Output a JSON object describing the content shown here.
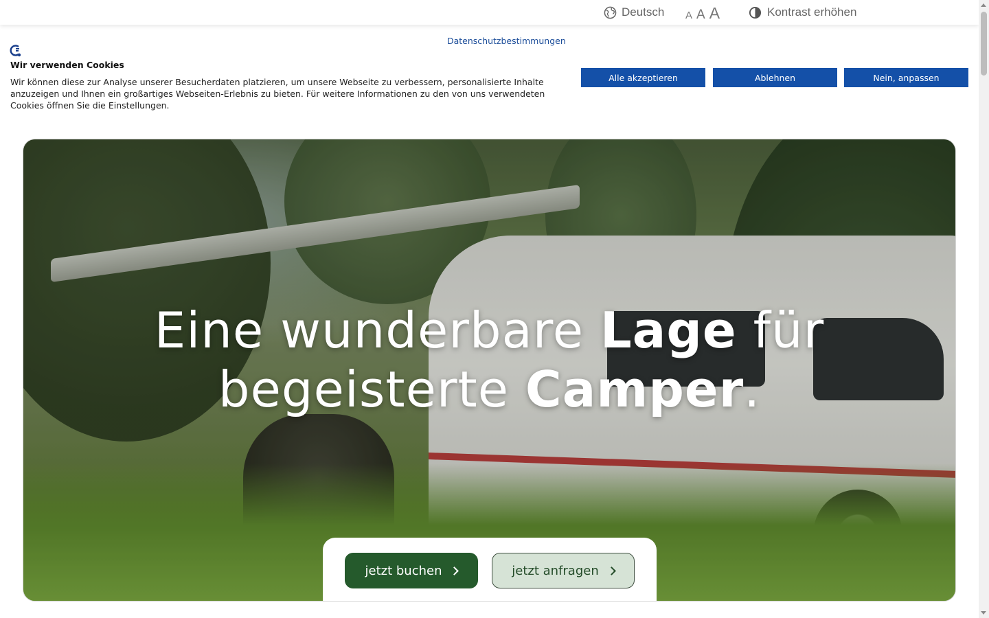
{
  "topbar": {
    "language_label": "Deutsch",
    "font_size_small": "A",
    "font_size_medium": "A",
    "font_size_large": "A",
    "contrast_label": "Kontrast erhöhen"
  },
  "cookie_banner": {
    "policy_link": "Datenschutzbestimmungen",
    "title": "Wir verwenden Cookies",
    "text": "Wir können diese zur Analyse unserer Besucherdaten platzieren, um unsere Webseite zu verbessern, personalisierte Inhalte anzuzeigen und Ihnen ein großartiges Webseiten-Erlebnis zu bieten. Für weitere Informationen zu den von uns verwendeten Cookies öffnen Sie die Einstellungen.",
    "accept_all": "Alle akzeptieren",
    "reject": "Ablehnen",
    "customize": "Nein, anpassen",
    "button_color": "#1450a8"
  },
  "hero": {
    "headline_part1": "Eine wunderbare ",
    "headline_bold1": "Lage",
    "headline_part2": " für",
    "headline_part3": "begeisterte ",
    "headline_bold2": "Camper",
    "headline_part4": ".",
    "cta_book": "jetzt buchen",
    "cta_inquire": "jetzt anfragen",
    "cta_book_color": "#255a2c",
    "cta_inquire_color": "#d6e3d6"
  },
  "icons": {
    "language": "globe-icon",
    "contrast": "contrast-icon",
    "cookie_logo": "cookie-consent-logo-icon",
    "cta": "chevron-right-icon"
  }
}
